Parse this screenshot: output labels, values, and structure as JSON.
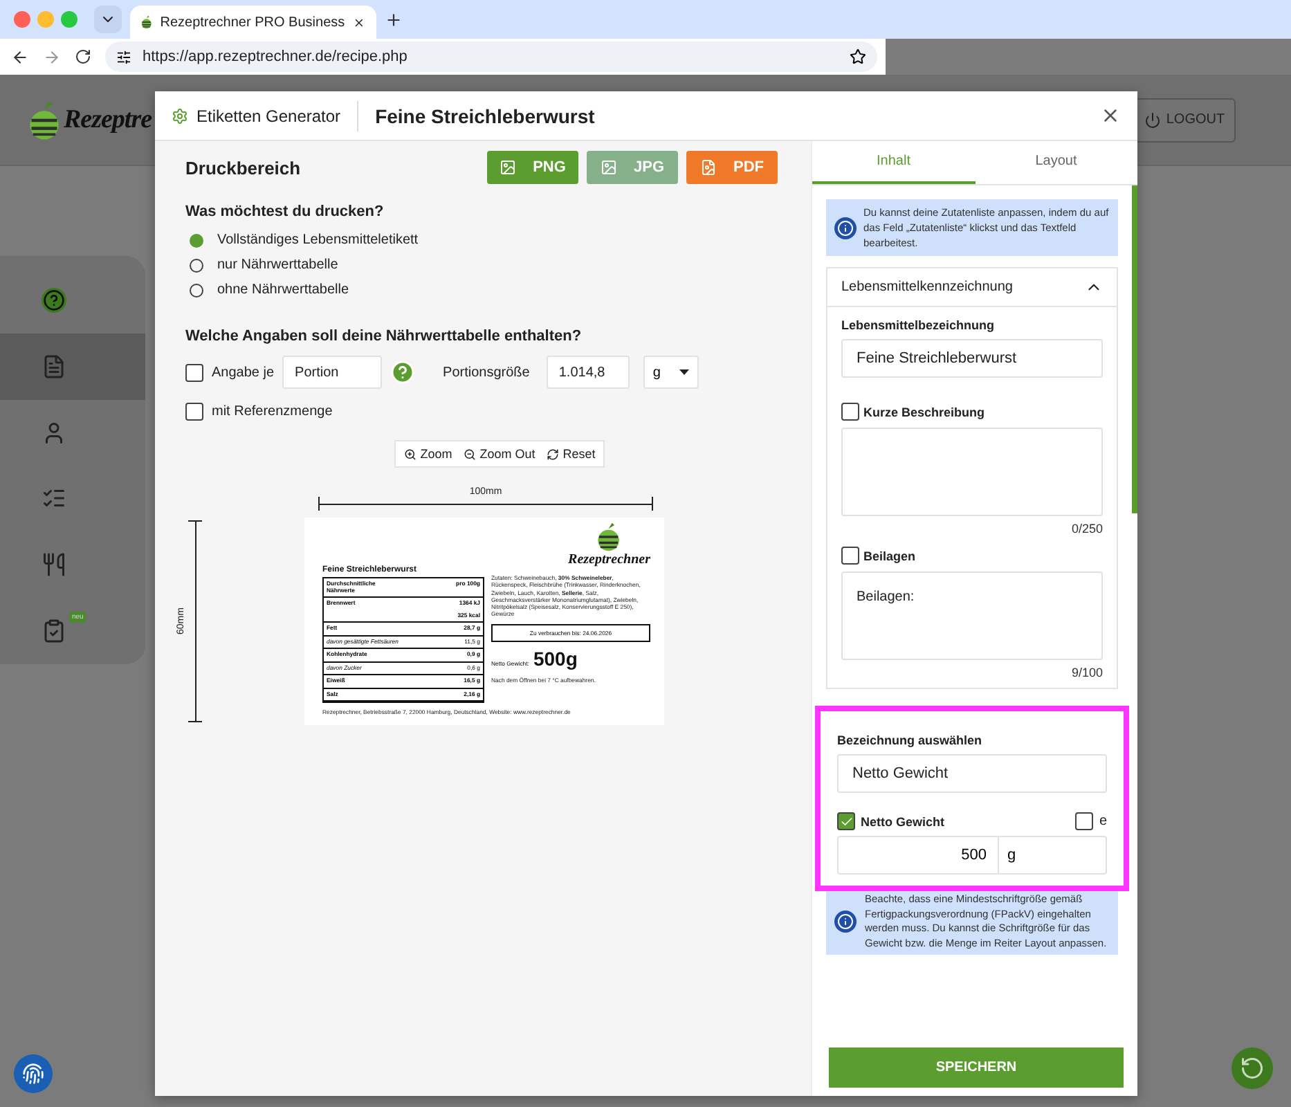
{
  "browser": {
    "tab_title": "Rezeptrechner PRO Business",
    "url": "https://app.rezeptrechner.de/recipe.php"
  },
  "app": {
    "logo_text": "Rezeptre",
    "logout": "LOGOUT",
    "sidebar": [
      {
        "kind": "help",
        "selected": false
      },
      {
        "kind": "recipe",
        "selected": true
      },
      {
        "kind": "user",
        "selected": false
      },
      {
        "kind": "checklist",
        "selected": false
      },
      {
        "kind": "plate",
        "selected": false
      },
      {
        "kind": "clipboard",
        "selected": false,
        "badge": "neu"
      }
    ]
  },
  "modal": {
    "generator_label": "Etiketten Generator",
    "title": "Feine Streichleberwurst"
  },
  "print_area": {
    "heading": "Druckbereich",
    "export_buttons": [
      {
        "label": "PNG",
        "kind": "png"
      },
      {
        "label": "JPG",
        "kind": "jpg"
      },
      {
        "label": "PDF",
        "kind": "pdf"
      }
    ],
    "question_print": "Was möchtest du drucken?",
    "print_options": [
      {
        "label": "Vollständiges Lebensmitteletikett",
        "selected": true
      },
      {
        "label": "nur Nährwerttabelle",
        "selected": false
      },
      {
        "label": "ohne Nährwerttabelle",
        "selected": false
      }
    ],
    "question_table": "Welche Angaben soll deine Nährwerttabelle enthalten?",
    "per_portion": {
      "label": "Angabe je",
      "checked": false,
      "value": "Portion"
    },
    "portion_size": {
      "label": "Portionsgröße",
      "value": "1.014,8",
      "unit": "g"
    },
    "reference": {
      "label": "mit Referenzmenge",
      "checked": false
    },
    "zoom_tools": [
      {
        "label": "Zoom",
        "kind": "zoom-in"
      },
      {
        "label": "Zoom Out",
        "kind": "zoom-out"
      },
      {
        "label": "Reset",
        "kind": "reset"
      }
    ]
  },
  "preview": {
    "width_label": "100mm",
    "height_label": "60mm",
    "label": {
      "title": "Feine Streichleberwurst",
      "logo_text": "Rezeptrechner",
      "table_header": [
        "Durchschnittliche Nährwerte",
        "pro 100g"
      ],
      "rows": [
        {
          "name": "Brennwert",
          "values": [
            "1364 kJ",
            "325 kcal"
          ],
          "sub": false
        },
        {
          "name": "Fett",
          "values": [
            "28,7 g"
          ],
          "sub": false
        },
        {
          "name": "davon gesättigte Fettsäuren",
          "values": [
            "11,5 g"
          ],
          "sub": true
        },
        {
          "name": "Kohlenhydrate",
          "values": [
            "0,9 g"
          ],
          "sub": false
        },
        {
          "name": "davon Zucker",
          "values": [
            "0,6 g"
          ],
          "sub": true
        },
        {
          "name": "Eiweiß",
          "values": [
            "16,5 g"
          ],
          "sub": false
        },
        {
          "name": "Salz",
          "values": [
            "2,16 g"
          ],
          "sub": false
        }
      ],
      "ingredients": "Zutaten: Schweinebauch, **30% Schweineleber**, Rückenspeck, Fleischbrühe (Trinkwasser, Rinderknochen, Zwiebeln, Lauch, Karotten, **Sellerie**, Salz, Geschmacksverstärker Mononatriumglutamat), Zwiebeln, Nitritpökelsalz (Speisesalz, Konservierungsstoff E 250), Gewürze",
      "best_before": "Zu verbrauchen bis: 24.06.2026",
      "net_label": "Netto Gewicht:",
      "net_value": "500g",
      "storage": "Nach dem Öffnen bei 7 °C aufbewahren.",
      "footer": "Rezeptrechner, Betriebsstraße 7, 22000 Hamburg, Deutschland, Website: www.rezeptrechner.de"
    }
  },
  "editor": {
    "tabs": [
      {
        "label": "Inhalt",
        "selected": true
      },
      {
        "label": "Layout",
        "selected": false
      }
    ],
    "info": "Du kannst deine Zutatenliste anpassen, indem du auf das Feld „Zutatenliste“ klickst und das Textfeld bearbeitest.",
    "accordion": {
      "title": "Lebensmittelkennzeichnung",
      "expanded": true
    },
    "name_field": {
      "label": "Lebensmittelbezeichnung",
      "value": "Feine Streichleberwurst"
    },
    "short_description": {
      "label": "Kurze Beschreibung",
      "checked": false,
      "counter": "0/250"
    },
    "sides": {
      "label": "Beilagen",
      "checked": false,
      "value": "Beilagen:",
      "counter": "9/100"
    },
    "weight": {
      "select_label": "Bezeichnung auswählen",
      "select_value": "Netto Gewicht",
      "checkbox_label": "Netto Gewicht",
      "checked": true,
      "e_label": "e",
      "e_checked": false,
      "amount": "500",
      "unit": "g"
    },
    "hint": "Beachte, dass eine Mindestschriftgröße gemäß Fertigpackungsverordnung (FPackV) eingehalten werden muss. Du kannst die Schriftgröße für das Gewicht bzw. die Menge im Reiter Layout anpassen.",
    "save": "SPEICHERN"
  }
}
